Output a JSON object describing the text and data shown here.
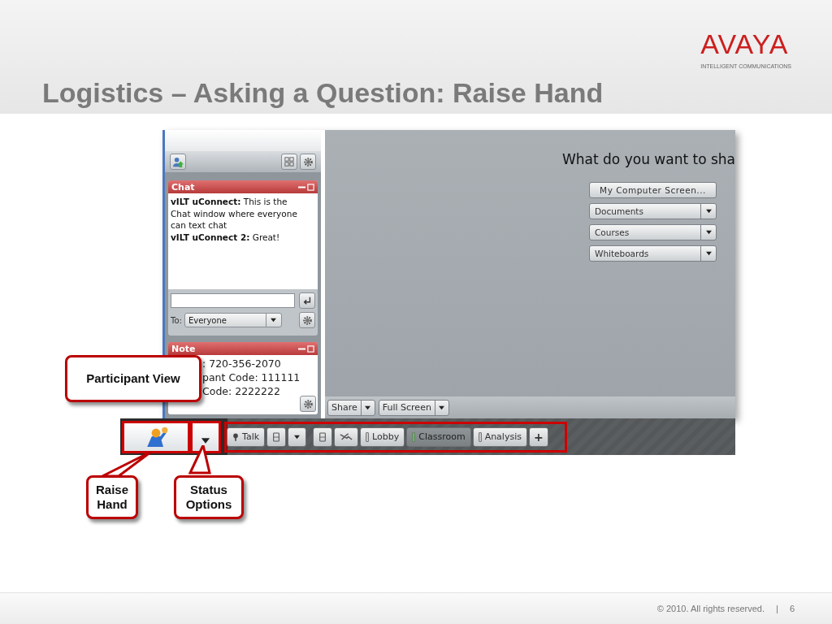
{
  "slide": {
    "title": "Logistics – Asking a Question: Raise Hand",
    "logo": "AVAYA",
    "tagline": "INTELLIGENT COMMUNICATIONS",
    "footer": "© 2010. All rights reserved.",
    "separator": "|",
    "page": "6"
  },
  "chat": {
    "title": "Chat",
    "messages": [
      {
        "sender": "vILT uConnect:",
        "text": "This is the Chat window where everyone can text chat"
      },
      {
        "sender": "vILT uConnect 2:",
        "text": "Great!"
      }
    ],
    "to_label": "To:",
    "recipient": "Everyone"
  },
  "note": {
    "title": "Note",
    "lines": [
      ": 720-356-2070",
      "pant Code: 111111",
      "Code: 2222222"
    ]
  },
  "share": {
    "prompt": "What do you want to sha",
    "options": [
      {
        "label": "My Computer Screen...",
        "kind": "button"
      },
      {
        "label": "Documents",
        "kind": "dropdown"
      },
      {
        "label": "Courses",
        "kind": "dropdown"
      },
      {
        "label": "Whiteboards",
        "kind": "dropdown"
      }
    ],
    "controls": [
      {
        "label": "Share"
      },
      {
        "label": "Full Screen"
      }
    ]
  },
  "toolbar": {
    "talk": "Talk",
    "rooms": [
      {
        "label": "Lobby",
        "selected": false
      },
      {
        "label": "Classroom",
        "selected": true
      },
      {
        "label": "Analysis",
        "selected": false
      }
    ],
    "add": "+"
  },
  "callouts": [
    {
      "text": "Participant View"
    },
    {
      "text": "Raise Hand"
    },
    {
      "text": "Status Options"
    }
  ]
}
